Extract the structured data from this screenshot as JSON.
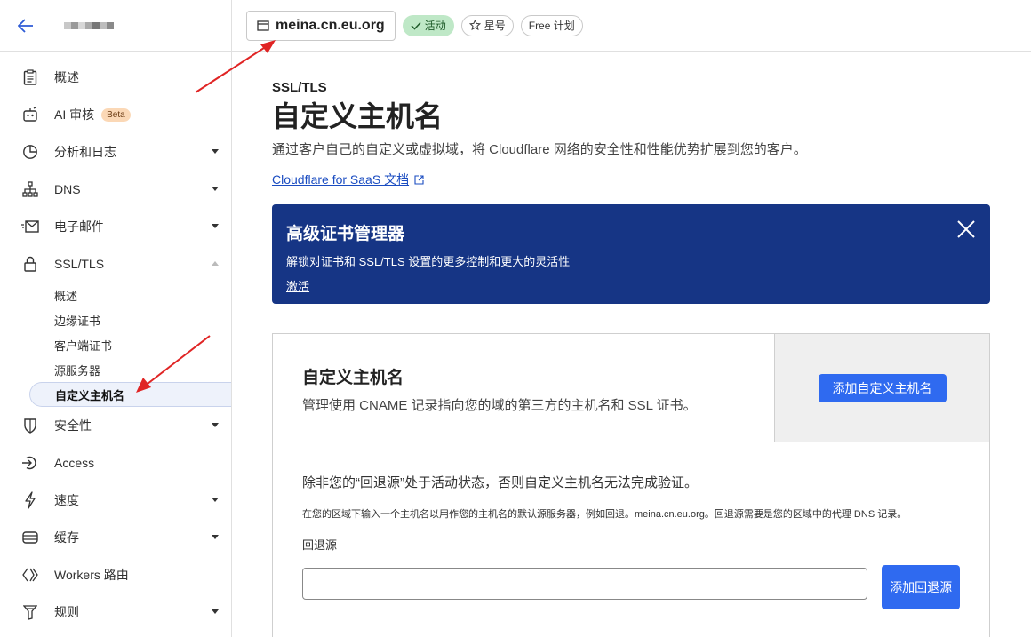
{
  "topbar": {
    "domain": "meina.cn.eu.org",
    "status": "活动",
    "star": "星号",
    "plan": "Free 计划"
  },
  "sidebar": {
    "items": [
      {
        "label": "概述",
        "icon": "clipboard-icon"
      },
      {
        "label": "AI 审核",
        "icon": "bot-icon",
        "badge": "Beta"
      },
      {
        "label": "分析和日志",
        "icon": "pie-chart-icon"
      },
      {
        "label": "DNS",
        "icon": "network-icon"
      },
      {
        "label": "电子邮件",
        "icon": "email-icon"
      },
      {
        "label": "SSL/TLS",
        "icon": "lock-icon"
      },
      {
        "label": "安全性",
        "icon": "shield-icon"
      },
      {
        "label": "Access",
        "icon": "access-icon"
      },
      {
        "label": "速度",
        "icon": "lightning-icon"
      },
      {
        "label": "缓存",
        "icon": "cache-icon"
      },
      {
        "label": "Workers 路由",
        "icon": "workers-icon"
      },
      {
        "label": "规则",
        "icon": "rules-icon"
      }
    ],
    "ssl_sub": [
      "概述",
      "边缘证书",
      "客户端证书",
      "源服务器",
      "自定义主机名"
    ]
  },
  "main": {
    "crumb": "SSL/TLS",
    "title": "自定义主机名",
    "description": "通过客户自己的自定义或虚拟域，将 Cloudflare 网络的安全性和性能优势扩展到您的客户。",
    "doc_link": "Cloudflare for SaaS 文档"
  },
  "banner": {
    "title": "高级证书管理器",
    "text": "解锁对证书和 SSL/TLS 设置的更多控制和更大的灵活性",
    "link": "激活",
    "bg": "#163585"
  },
  "card": {
    "title": "自定义主机名",
    "desc": "管理使用 CNAME 记录指向您的域的第三方的主机名和 SSL 证书。",
    "add_button": "添加自定义主机名",
    "warning": "除非您的“回退源”处于活动状态，否则自定义主机名无法完成验证。",
    "hint": "在您的区域下输入一个主机名以用作您的主机名的默认源服务器，例如回退。meina.cn.eu.org。回退源需要是您的区域中的代理 DNS 记录。",
    "field_label": "回退源",
    "field_value": "",
    "submit_button": "添加回退源"
  },
  "colors": {
    "accent": "#2f6af0",
    "annotation_arrow": "#e02424"
  }
}
